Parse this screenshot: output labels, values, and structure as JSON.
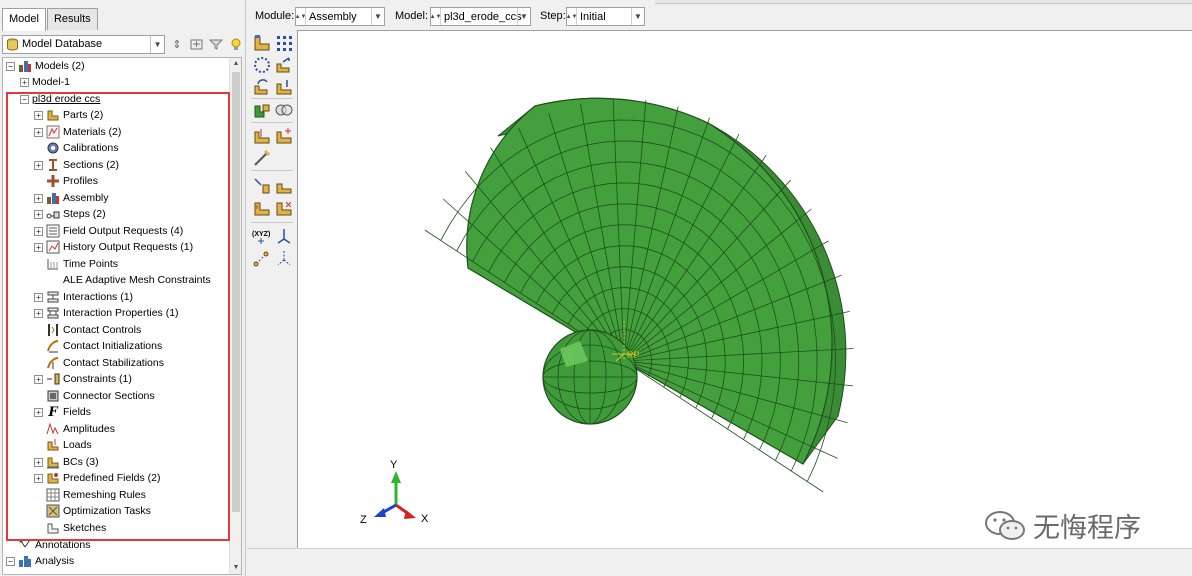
{
  "tabs": [
    {
      "label": "Model"
    },
    {
      "label": "Results"
    }
  ],
  "db_selector": {
    "value": "Model Database"
  },
  "tree": {
    "items": [
      {
        "label": "Models (2)"
      },
      {
        "label": "Model-1"
      },
      {
        "label": "pl3d erode ccs"
      },
      {
        "label": "Parts (2)"
      },
      {
        "label": "Materials (2)"
      },
      {
        "label": "Calibrations"
      },
      {
        "label": "Sections (2)"
      },
      {
        "label": "Profiles"
      },
      {
        "label": "Assembly"
      },
      {
        "label": "Steps (2)"
      },
      {
        "label": "Field Output Requests (4)"
      },
      {
        "label": "History Output Requests (1)"
      },
      {
        "label": "Time Points"
      },
      {
        "label": "ALE Adaptive Mesh Constraints"
      },
      {
        "label": "Interactions (1)"
      },
      {
        "label": "Interaction Properties (1)"
      },
      {
        "label": "Contact Controls"
      },
      {
        "label": "Contact Initializations"
      },
      {
        "label": "Contact Stabilizations"
      },
      {
        "label": "Constraints (1)"
      },
      {
        "label": "Connector Sections"
      },
      {
        "label": "Fields"
      },
      {
        "label": "Amplitudes"
      },
      {
        "label": "Loads"
      },
      {
        "label": "BCs (3)"
      },
      {
        "label": "Predefined Fields (2)"
      },
      {
        "label": "Remeshing Rules"
      },
      {
        "label": "Optimization Tasks"
      },
      {
        "label": "Sketches"
      },
      {
        "label": "Annotations"
      },
      {
        "label": "Analysis"
      }
    ]
  },
  "context": {
    "module_label": "Module:",
    "module_value": "Assembly",
    "model_label": "Model:",
    "model_value": "pl3d_erode_ccs",
    "step_label": "Step:",
    "step_value": "Initial"
  },
  "viewport": {
    "rp_label": "RP",
    "triad": {
      "y": "Y",
      "z": "Z",
      "x": "X"
    }
  },
  "watermark": {
    "text": "无悔程序"
  },
  "colors": {
    "mesh_green": "#3f9a3a",
    "mesh_dark": "#2e7d2b",
    "highlight_red": "#e5383b",
    "triad_y": "#2bb52b",
    "triad_x": "#d22222",
    "triad_z": "#1e3fd0"
  }
}
